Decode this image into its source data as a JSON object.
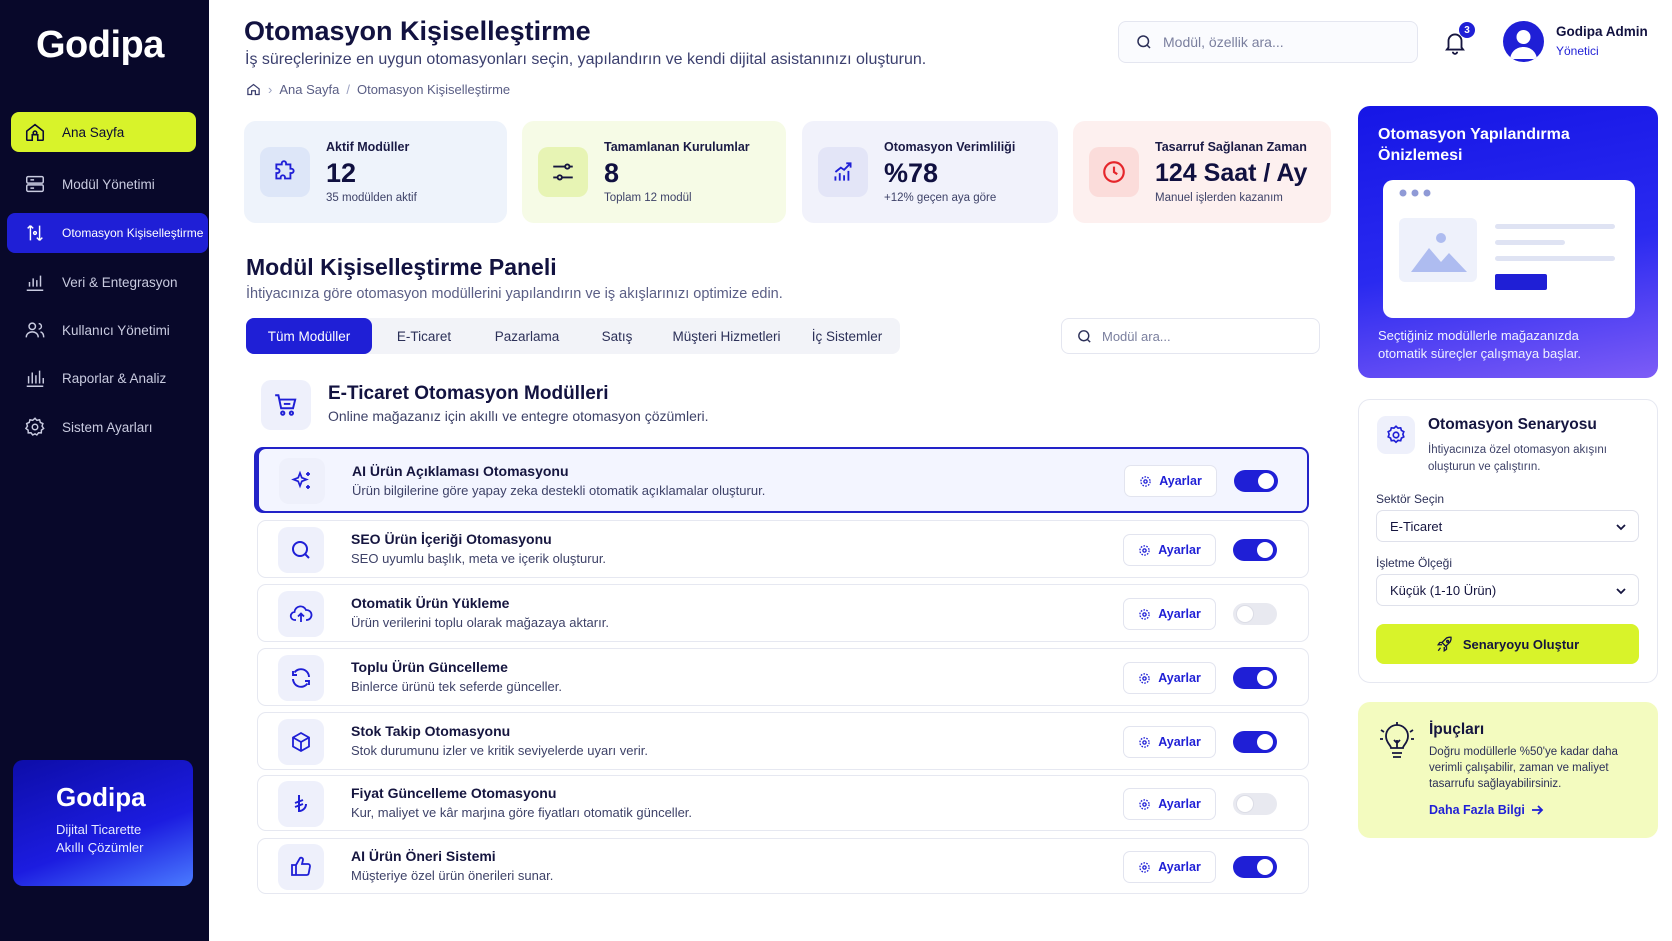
{
  "brand": {
    "name": "Godipa"
  },
  "sidebar": {
    "items": [
      {
        "label": "Ana Sayfa",
        "icon": "home-icon"
      },
      {
        "label": "Modül Yönetimi",
        "icon": "modules-icon"
      },
      {
        "label": "Otomasyon Kişiselleştirme",
        "icon": "automation-icon"
      },
      {
        "label": "Veri & Entegrasyon",
        "icon": "chart-icon"
      },
      {
        "label": "Kullanıcı Yönetimi",
        "icon": "users-icon"
      },
      {
        "label": "Raporlar & Analiz",
        "icon": "reports-icon"
      },
      {
        "label": "Sistem Ayarları",
        "icon": "gear-icon"
      }
    ],
    "promo": {
      "title": "Godipa",
      "line1": "Dijital Ticarette",
      "line2": "Akıllı Çözümler"
    }
  },
  "header": {
    "title": "Otomasyon Kişiselleştirme",
    "subtitle": "İş süreçlerinize en uygun otomasyonları seçin, yapılandırın ve kendi dijital asistanınızı oluşturun.",
    "breadcrumb": [
      "Ana Sayfa",
      "Otomasyon Kişiselleştirme"
    ],
    "search_placeholder": "Modül, özellik ara...",
    "notification_count": "3",
    "user": {
      "name": "Godipa Admin",
      "role": "Yönetici"
    }
  },
  "stats": [
    {
      "label": "Aktif Modüller",
      "value": "12",
      "sub": "35 modülden aktif",
      "bg": "#eef3fb",
      "iconbg": "#dde6f8",
      "icon": "puzzle-icon"
    },
    {
      "label": "Tamamlanan Kurulumlar",
      "value": "8",
      "sub": "Toplam 12 modül",
      "bg": "#f6fbe6",
      "iconbg": "#e7f4b4",
      "icon": "sliders-icon"
    },
    {
      "label": "Otomasyon Verimliliği",
      "value": "%78",
      "sub": "+12% geçen aya göre",
      "bg": "#f1f2fb",
      "iconbg": "#e3e5f7",
      "icon": "growth-chart-icon"
    },
    {
      "label": "Tasarruf Sağlanan Zaman",
      "value": "124 Saat / Ay",
      "sub": "Manuel işlerden kazanım",
      "bg": "#fdf0ef",
      "iconbg": "#fbdcda",
      "icon": "clock-icon"
    }
  ],
  "panel": {
    "title": "Modül Kişiselleştirme Paneli",
    "subtitle": "İhtiyacınıza göre otomasyon modüllerini yapılandırın ve iş akışlarınızı optimize edin.",
    "tabs": [
      "Tüm Modüller",
      "E-Ticaret",
      "Pazarlama",
      "Satış",
      "Müşteri Hizmetleri",
      "İç Sistemler"
    ],
    "search_placeholder": "Modül ara..."
  },
  "section": {
    "title": "E-Ticaret Otomasyon Modülleri",
    "subtitle": "Online mağazanız için akıllı ve entegre otomasyon çözümleri."
  },
  "modules": [
    {
      "title": "AI Ürün Açıklaması Otomasyonu",
      "desc": "Ürün bilgilerine göre yapay zeka destekli otomatik açıklamalar oluşturur.",
      "enabled": true,
      "icon": "sparkles-icon",
      "settings": "Ayarlar"
    },
    {
      "title": "SEO Ürün İçeriği Otomasyonu",
      "desc": "SEO uyumlu başlık, meta ve içerik oluşturur.",
      "enabled": true,
      "icon": "search-icon",
      "settings": "Ayarlar"
    },
    {
      "title": "Otomatik Ürün Yükleme",
      "desc": "Ürün verilerini toplu olarak mağazaya aktarır.",
      "enabled": false,
      "icon": "cloud-upload-icon",
      "settings": "Ayarlar"
    },
    {
      "title": "Toplu Ürün Güncelleme",
      "desc": "Binlerce ürünü tek seferde günceller.",
      "enabled": true,
      "icon": "refresh-icon",
      "settings": "Ayarlar"
    },
    {
      "title": "Stok Takip Otomasyonu",
      "desc": "Stok durumunu izler ve kritik seviyelerde uyarı verir.",
      "enabled": true,
      "icon": "box-icon",
      "settings": "Ayarlar"
    },
    {
      "title": "Fiyat Güncelleme Otomasyonu",
      "desc": "Kur, maliyet ve kâr marjına göre fiyatları otomatik günceller.",
      "enabled": false,
      "icon": "lira-icon",
      "settings": "Ayarlar"
    },
    {
      "title": "AI Ürün Öneri Sistemi",
      "desc": "Müşteriye özel ürün önerileri sunar.",
      "enabled": true,
      "icon": "thumbs-up-icon",
      "settings": "Ayarlar"
    }
  ],
  "preview": {
    "title": "Otomasyon Yapılandırma Önizlemesi",
    "footer": "Seçtiğiniz modüllerle mağazanızda otomatik süreçler çalışmaya başlar."
  },
  "scenario": {
    "title": "Otomasyon Senaryosu",
    "subtitle": "İhtiyacınıza özel otomasyon akışını oluşturun ve çalıştırın.",
    "sector_label": "Sektör Seçin",
    "sector_value": "E-Ticaret",
    "scale_label": "İşletme Ölçeği",
    "scale_value": "Küçük (1-10 Ürün)",
    "button": "Senaryoyu Oluştur"
  },
  "tips": {
    "title": "İpuçları",
    "body": "Doğru modüllerle %50'ye kadar daha verimli çalışabilir, zaman ve maliyet tasarrufu sağlayabilirsiniz.",
    "link": "Daha Fazla Bilgi"
  },
  "colors": {
    "accent": "#1f1fd6",
    "lime": "#d8f32a",
    "sidebar": "#08082a"
  }
}
